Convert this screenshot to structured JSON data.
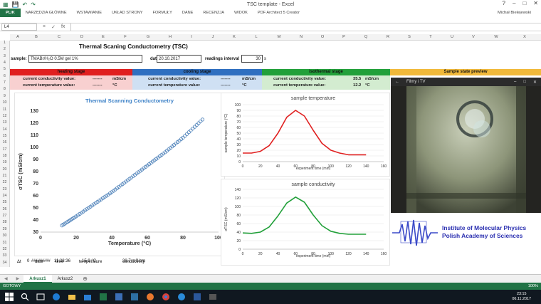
{
  "window": {
    "title": "TSC template - Excel"
  },
  "ribbon": {
    "tabs": [
      "PLIK",
      "NARZĘDZIA GŁÓWNE",
      "WSTAWIANIE",
      "UKŁAD STRONY",
      "FORMUŁY",
      "DANE",
      "RECENZJA",
      "WIDOK",
      "PDF Architect 5 Creator"
    ],
    "user": "Michał Bielejewski"
  },
  "formula_bar": {
    "name_box": "L4",
    "icons": [
      "×",
      "✓",
      "fx"
    ]
  },
  "columns": [
    "A",
    "B",
    "C",
    "D",
    "E",
    "F",
    "G",
    "H",
    "I",
    "J",
    "K",
    "L",
    "M",
    "N",
    "O",
    "P",
    "Q",
    "R",
    "S",
    "T",
    "U",
    "V",
    "W",
    "X"
  ],
  "rows": [
    "1",
    "2",
    "3",
    "4",
    "5",
    "6",
    "7",
    "8",
    "9",
    "10",
    "11",
    "12",
    "13",
    "14",
    "15",
    "16",
    "17",
    "18",
    "19",
    "20",
    "21",
    "22",
    "23",
    "24",
    "25",
    "26",
    "27",
    "28",
    "29",
    "30",
    "31",
    "32",
    "33",
    "34"
  ],
  "sheet": {
    "title": "Thermal Scaning Conductometry (TSC)",
    "sample_label": "sample:",
    "sample_value": "TMABr/H₂O 0.5M gel 1%",
    "date_label": "date:",
    "date_value": "20.10.2017",
    "interval_label": "readings interval",
    "interval_value": "30",
    "interval_unit": "s"
  },
  "stages": {
    "heating": {
      "title": "heating stage",
      "cond_label": "current conductivity value:",
      "cond_value": "-------",
      "cond_unit": "mS/cm",
      "temp_label": "current temperature value:",
      "temp_value": "-------",
      "temp_unit": "°C",
      "color": "#e02020",
      "bg": "#f8d0d0"
    },
    "cooling": {
      "title": "cooling stage",
      "cond_label": "current conductivity value:",
      "cond_value": "-------",
      "cond_unit": "mS/cm",
      "temp_label": "current temperature value:",
      "temp_value": "-------",
      "temp_unit": "°C",
      "color": "#2f6fc0",
      "bg": "#cfe0f3"
    },
    "isothermal": {
      "title": "isothermal stage",
      "cond_label": "current conductivity value:",
      "cond_value": "35.5",
      "cond_unit": "mS/cm",
      "temp_label": "current temperature value:",
      "temp_value": "12.2",
      "temp_unit": "°C",
      "color": "#22a03a",
      "bg": "#d3ecd0"
    },
    "preview": {
      "title": "Sample state preview",
      "color": "#f1b93a"
    }
  },
  "video": {
    "app": "Filmy i TV"
  },
  "logo": {
    "line1": "Institute of Molecular Physics",
    "line2": "Polish Academy of Sciences"
  },
  "data_header": {
    "c1": "Δt",
    "c2": "date",
    "c3": "time",
    "c4": "temperature",
    "c5": "conductivity"
  },
  "data_row": {
    "c1": "0",
    "c2": "########",
    "c3": "11:28:36",
    "c4": "15.9 °C",
    "c5": "38.7 mS/cm"
  },
  "sheet_tabs": [
    "Arkusz1",
    "Arkusz2"
  ],
  "status": {
    "left": "GOTOWY",
    "zoom": "100%"
  },
  "clock": {
    "time": "23:15",
    "date": "06.11.2017"
  },
  "chart_data": [
    {
      "type": "scatter",
      "title": "Thermal Scanning Conductometry",
      "xlabel": "Temperature (°C)",
      "ylabel": "σTSC (mS/cm)",
      "xlim": [
        0,
        100
      ],
      "ylim": [
        30,
        130
      ],
      "xticks": [
        0,
        20,
        40,
        60,
        80,
        100
      ],
      "yticks": [
        30,
        40,
        50,
        60,
        70,
        80,
        90,
        100,
        110,
        120,
        130
      ],
      "series": [
        {
          "x": [
            12,
            20,
            30,
            40,
            50,
            60,
            70,
            80,
            91
          ],
          "y": [
            35.5,
            43,
            53,
            63,
            74,
            85,
            96,
            108,
            123
          ],
          "color": "#4a7fb8"
        }
      ]
    },
    {
      "type": "line",
      "title": "sample temperature",
      "xlabel": "experiment time (min)",
      "ylabel": "sample temperature (°C)",
      "xlim": [
        0,
        160
      ],
      "ylim": [
        0,
        100
      ],
      "xticks": [
        0,
        20,
        40,
        60,
        80,
        100,
        120,
        140,
        160
      ],
      "yticks": [
        0,
        10,
        20,
        30,
        40,
        50,
        60,
        70,
        80,
        90,
        100
      ],
      "series": [
        {
          "x": [
            0,
            10,
            20,
            30,
            40,
            50,
            60,
            70,
            80,
            90,
            100,
            110,
            120,
            130,
            140
          ],
          "y": [
            15,
            15,
            18,
            28,
            50,
            78,
            90,
            80,
            55,
            32,
            20,
            15,
            12,
            12,
            12
          ],
          "color": "#e02020"
        }
      ]
    },
    {
      "type": "line",
      "title": "sample conductivity",
      "xlabel": "experiment time (min)",
      "ylabel": "σTSC (mS/cm)",
      "xlim": [
        0,
        160
      ],
      "ylim": [
        0,
        140
      ],
      "xticks": [
        0,
        20,
        40,
        60,
        80,
        100,
        120,
        140,
        160
      ],
      "yticks": [
        0,
        20,
        40,
        60,
        80,
        100,
        120,
        140
      ],
      "series": [
        {
          "x": [
            0,
            10,
            20,
            30,
            40,
            50,
            60,
            70,
            80,
            90,
            100,
            110,
            120,
            130,
            140
          ],
          "y": [
            38,
            37,
            40,
            52,
            78,
            108,
            122,
            110,
            80,
            55,
            42,
            37,
            35,
            35,
            35
          ],
          "color": "#22a03a"
        }
      ]
    }
  ]
}
